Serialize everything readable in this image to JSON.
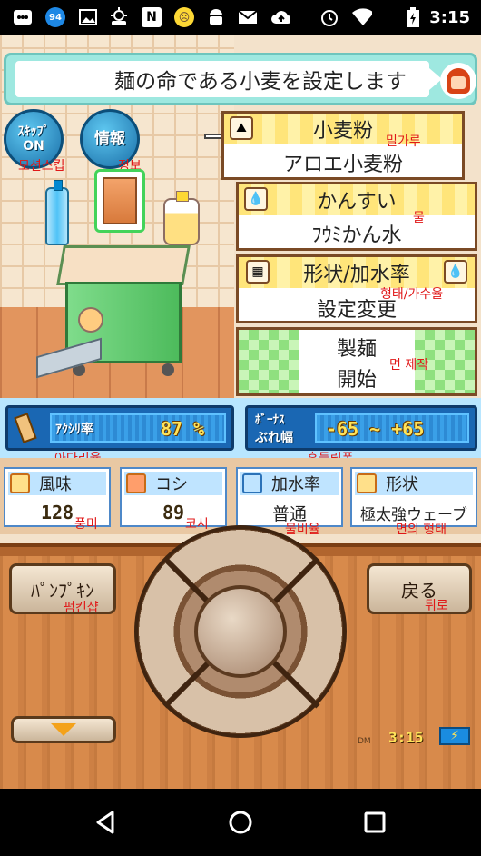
{
  "status_bar": {
    "badge_count": "94",
    "n_label": "N",
    "time": "3:15",
    "icons": [
      "menu-icon",
      "badge-94-icon",
      "image-icon",
      "weather-icon",
      "n-app-icon",
      "emoji-face-icon",
      "android-icon",
      "mail-icon",
      "cloud-upload-icon",
      "alarm-icon",
      "wifi-icon",
      "battery-charging-icon"
    ]
  },
  "header": {
    "message": "麺の命である小麦を設定します"
  },
  "buttons": {
    "skip": {
      "line1": "ｽｷｯﾌﾟ",
      "line2": "ON",
      "ko": "모션스킵"
    },
    "info": {
      "label": "情報",
      "ko": "정보"
    }
  },
  "panels": {
    "flour": {
      "title": "小麦粉",
      "value": "アロエ小麦粉",
      "ko": "밀가루"
    },
    "kansui": {
      "title": "かんすい",
      "value": "ﾌｳﾐかん水",
      "ko": "물"
    },
    "shape": {
      "title": "形状/加水率",
      "value": "設定変更",
      "ko": "형태/가수율"
    },
    "start": {
      "line1": "製麺",
      "line2": "開始",
      "ko": "면 제작"
    }
  },
  "rates": {
    "aku": {
      "label": "ｱｸｼﾘ率",
      "value": "87 %",
      "ko": "아다리율"
    },
    "bonus": {
      "label_top": "ﾎﾞｰﾅｽ",
      "label_bottom": "ぶれ幅",
      "value": "-65 ~ +65",
      "ko": "흔들림폭"
    }
  },
  "stats": [
    {
      "label": "風味",
      "value": "128",
      "ko": "풍미"
    },
    {
      "label": "コシ",
      "value": "89",
      "ko": "코시"
    },
    {
      "label": "加水率",
      "value": "普通",
      "ko": "물비율"
    },
    {
      "label": "形状",
      "value": "極太強ウェーブ",
      "ko": "면의 형태"
    }
  ],
  "controls": {
    "pumpkin": {
      "label": "ﾊﾟﾝﾌﾟｷﾝ",
      "ko": "펌킨샵"
    },
    "back": {
      "label": "戻る",
      "ko": "뒤로"
    },
    "dm": "DM",
    "game_time": "3:15"
  }
}
